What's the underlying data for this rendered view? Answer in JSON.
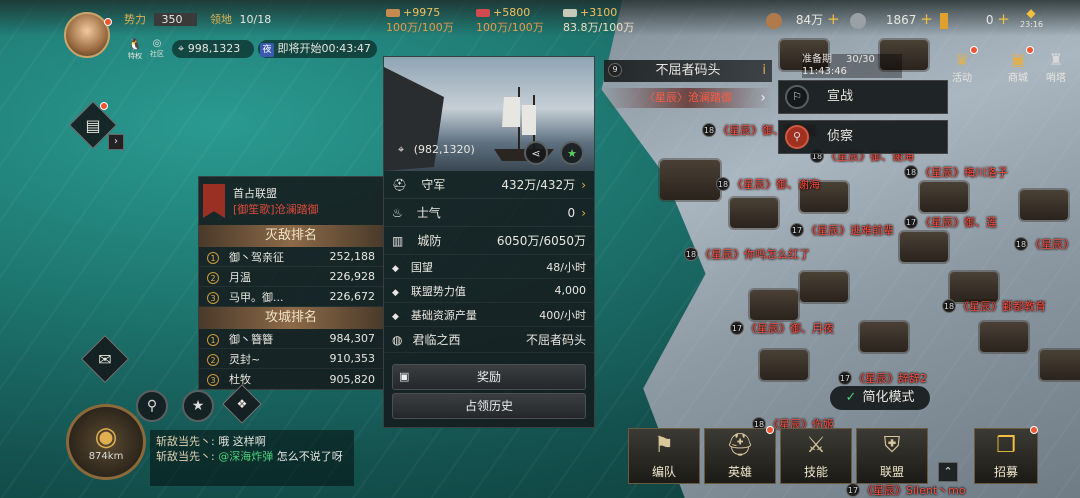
{
  "player": {
    "power_label": "势力",
    "power_value": "350",
    "territory_label": "领地",
    "territory_value": "10/18",
    "vip_label": "特权",
    "community_label": "社区",
    "coords": "998,1323",
    "night_badge": "夜",
    "countdown": "即将开始00:43:47"
  },
  "resources_mid": [
    {
      "icon": "wood-icon",
      "delta": "+9975",
      "cap": "100万/100万"
    },
    {
      "icon": "iron-icon",
      "delta": "+5800",
      "cap": "100万/100万"
    },
    {
      "icon": "grain-icon",
      "delta": "+3100",
      "cap": "83.8万/100万"
    }
  ],
  "resources_right": [
    {
      "icon": "copper-icon",
      "value": "84万",
      "plus": "+"
    },
    {
      "icon": "silver-icon",
      "value": "1867",
      "plus": "+"
    },
    {
      "icon": "gold-icon",
      "value": "0",
      "plus": "+"
    }
  ],
  "time": "23:16",
  "city_popup": {
    "image_alt": "sailing ships",
    "coords": "(982,1320)",
    "stats": [
      {
        "icon": "helmet-icon",
        "label": "守军",
        "value": "432万/432万",
        "arrow": true
      },
      {
        "icon": "flame-icon",
        "label": "士气",
        "value": "0",
        "arrow": true
      },
      {
        "icon": "wall-icon",
        "label": "城防",
        "value": "6050万/6050万",
        "arrow": false
      }
    ],
    "info": [
      {
        "label": "国望",
        "value": "48/小时"
      },
      {
        "label": "联盟势力值",
        "value": "4,000"
      },
      {
        "label": "基础资源产量",
        "value": "400/小时"
      }
    ],
    "lord_label": "君临之西",
    "lord_value": "不屈者码头",
    "reward_button": "奖励",
    "history_button": "占领历史"
  },
  "alliance_panel": {
    "first_label": "首占联盟",
    "first_value": "[御笙歌]沧澜踏御",
    "kill_title": "灭敌排名",
    "kill_rank": [
      {
        "rank": "1",
        "name": "御丶驾亲征",
        "value": "252,188"
      },
      {
        "rank": "2",
        "name": "月温",
        "value": "226,928"
      },
      {
        "rank": "3",
        "name": "马甲。御...",
        "value": "226,672"
      }
    ],
    "siege_title": "攻城排名",
    "siege_rank": [
      {
        "rank": "1",
        "name": "御丶簪簪",
        "value": "984,307"
      },
      {
        "rank": "2",
        "name": "灵封~",
        "value": "910,353"
      },
      {
        "rank": "3",
        "name": "杜牧",
        "value": "905,820"
      }
    ]
  },
  "target": {
    "level": "9",
    "name": "不屈者码头",
    "owner": "〈星辰〉沧澜踏御",
    "prep_label": "准备期",
    "prep_time": "11:43:46",
    "troops": "30/30"
  },
  "actions": {
    "declare": "宣战",
    "scout": "侦察",
    "activity": "活动",
    "shop": "商城",
    "lookout": "哨塔",
    "simplify": "简化模式"
  },
  "bottom": {
    "formation": "编队",
    "hero": "英雄",
    "skill": "技能",
    "alliance": "联盟",
    "recruit": "招募",
    "distance": "874km"
  },
  "chat": [
    {
      "name": "斩敌当先丶:",
      "text": "哦  这样啊"
    },
    {
      "name": "斩敌当先丶:",
      "mention": "@深海炸弹",
      "text": "怎么不说了呀"
    }
  ],
  "map_labels": [
    {
      "lv": "18",
      "text": "《星辰》御、驾亲征"
    },
    {
      "lv": "18",
      "text": "《星辰》御、谢海"
    },
    {
      "lv": "18",
      "text": "《星辰》御、谢海"
    },
    {
      "lv": "18",
      "text": "《星辰》梅川洛子"
    },
    {
      "lv": "17",
      "text": "《星辰》逃难前辈"
    },
    {
      "lv": "17",
      "text": "《星辰》御、莲"
    },
    {
      "lv": "18",
      "text": "《星辰》你吗怎么红了"
    },
    {
      "lv": "18",
      "text": "《星辰》"
    },
    {
      "lv": "18",
      "text": "《星辰》鄞都教育"
    },
    {
      "lv": "17",
      "text": "《星辰》御、月夜"
    },
    {
      "lv": "17",
      "text": "《星辰》辞辞2"
    },
    {
      "lv": "18",
      "text": "《星辰》伤姬"
    },
    {
      "lv": "17",
      "text": "《星辰》Silent丶mo"
    }
  ]
}
